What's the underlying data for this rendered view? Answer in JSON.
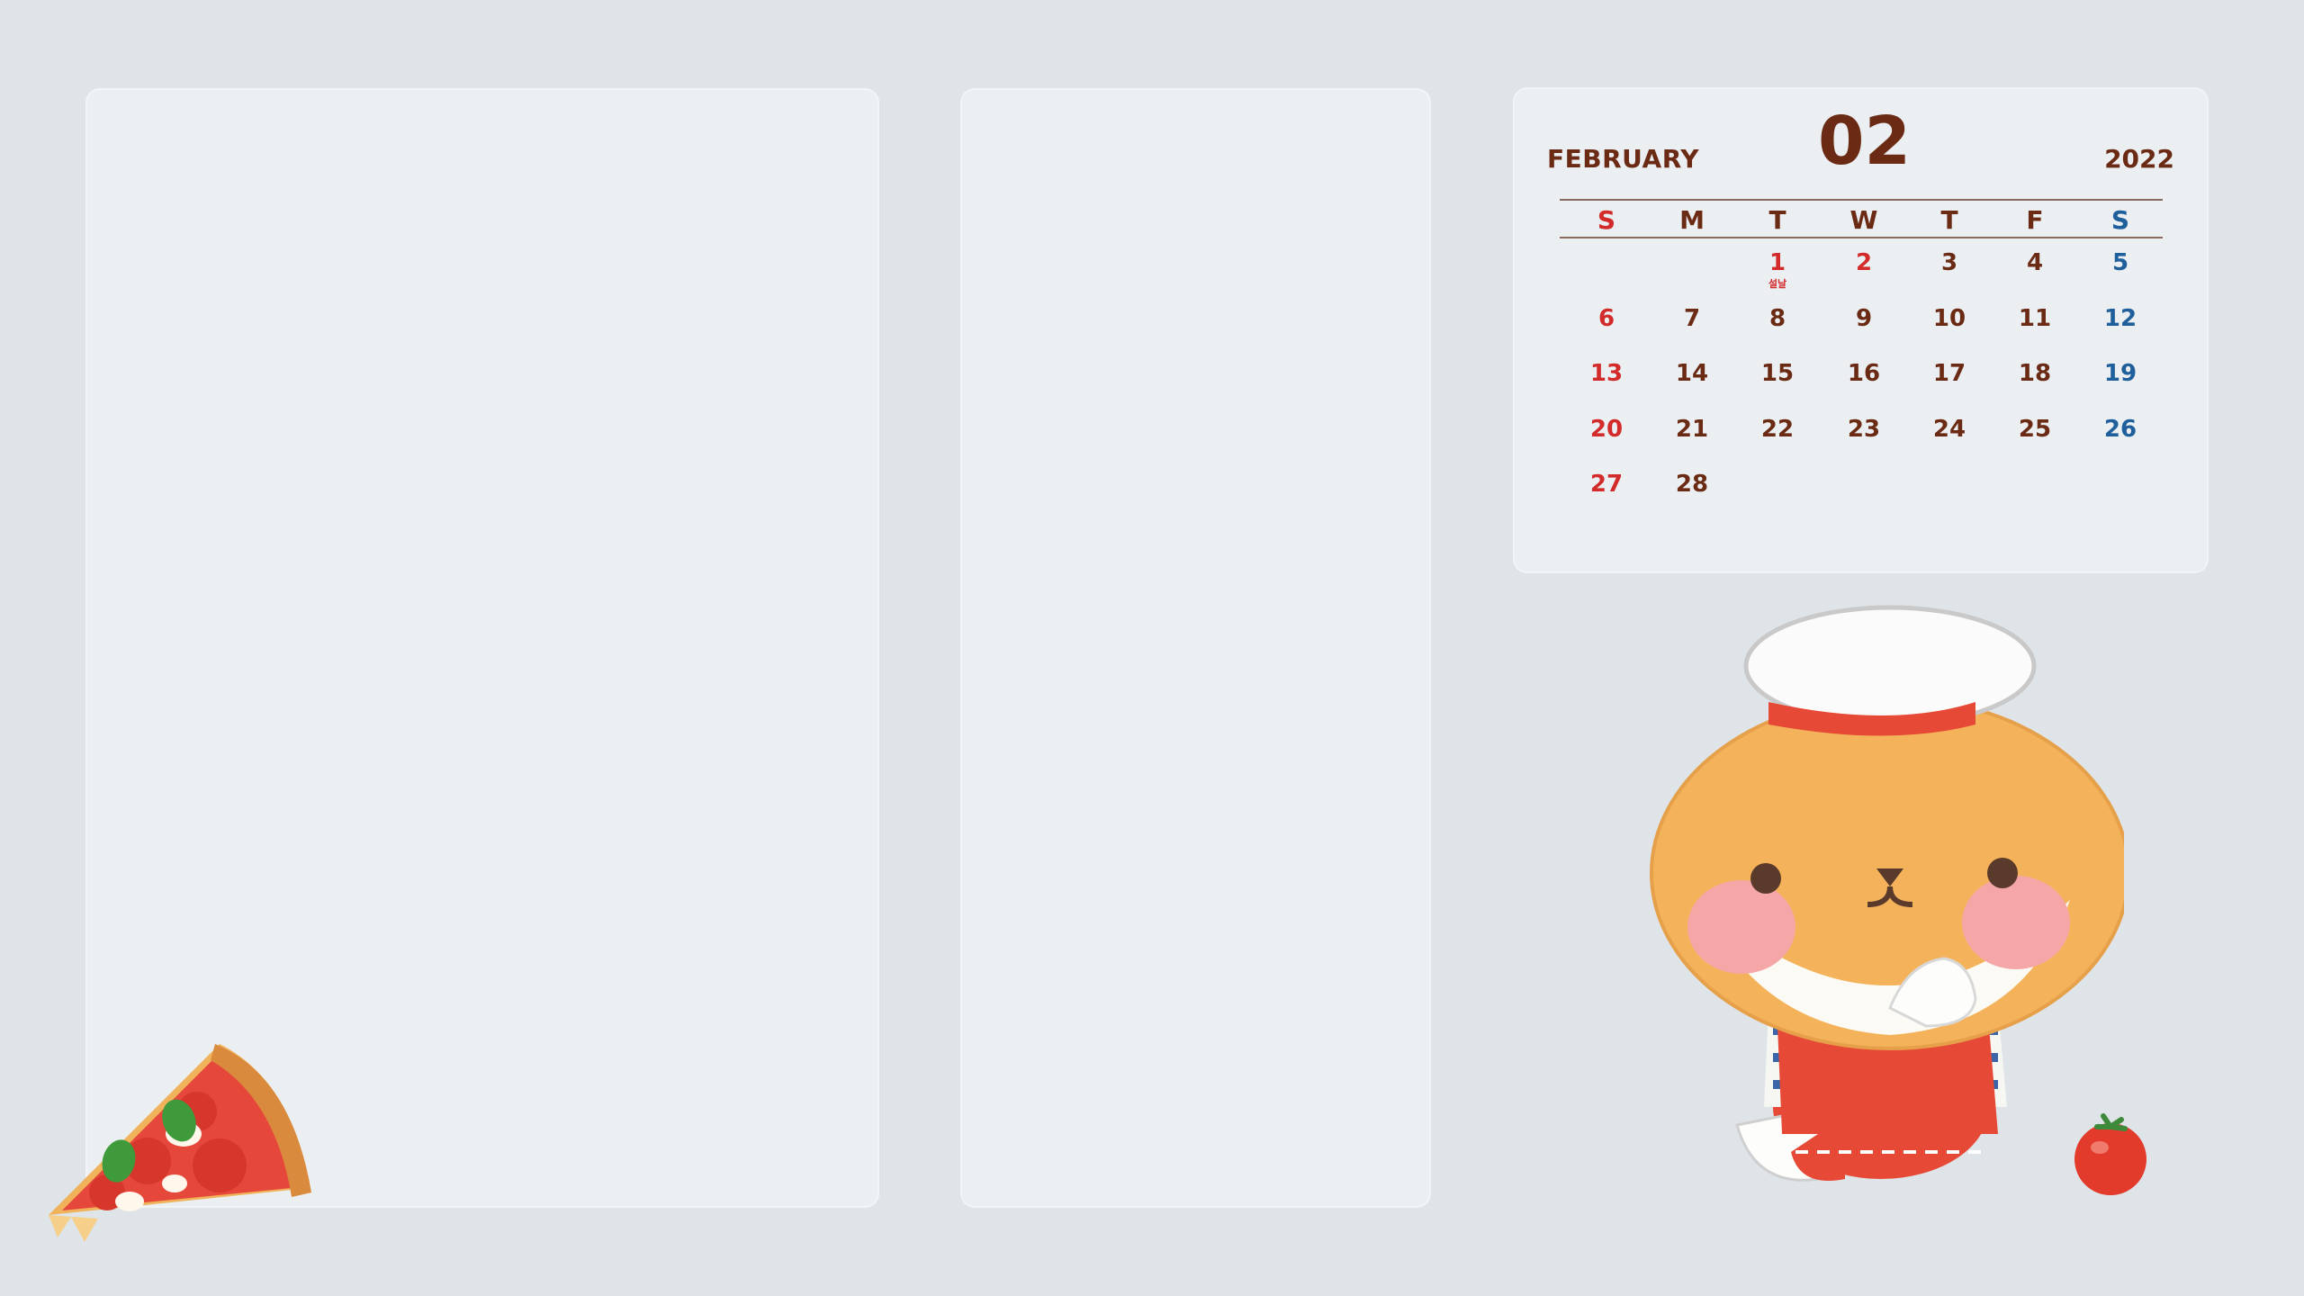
{
  "calendar": {
    "month_name": "FEBRUARY",
    "month_number": "02",
    "year": "2022",
    "weekdays": [
      "S",
      "M",
      "T",
      "W",
      "T",
      "F",
      "S"
    ],
    "weeks": [
      [
        "",
        "",
        "1",
        "2",
        "3",
        "4",
        "5"
      ],
      [
        "6",
        "7",
        "8",
        "9",
        "10",
        "11",
        "12"
      ],
      [
        "13",
        "14",
        "15",
        "16",
        "17",
        "18",
        "19"
      ],
      [
        "20",
        "21",
        "22",
        "23",
        "24",
        "25",
        "26"
      ],
      [
        "27",
        "28",
        "",
        "",
        "",
        "",
        ""
      ]
    ],
    "holidays": [
      "1",
      "2"
    ],
    "holiday_note": {
      "day": "1",
      "text": "설날"
    }
  },
  "illustrations": {
    "pizza": "pizza-slice",
    "hamster": "hamster-chef",
    "tomato": "tomato"
  },
  "colors": {
    "background": "#dfe4e8",
    "panel": "#ebeff2",
    "text_brown": "#6a2a13",
    "sunday_red": "#d32a2a",
    "saturday_blue": "#1f5f9c"
  }
}
